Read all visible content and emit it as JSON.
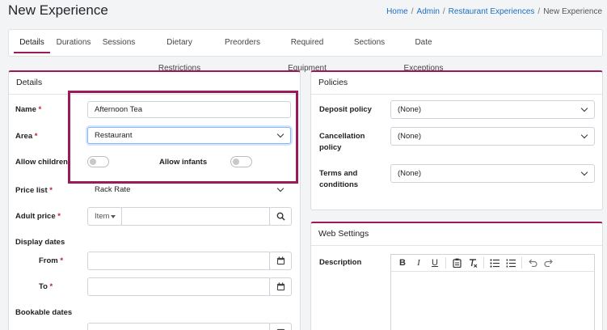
{
  "page": {
    "title": "New Experience"
  },
  "breadcrumb": {
    "items": [
      "Home",
      "Admin",
      "Restaurant Experiences"
    ],
    "current": "New Experience",
    "separator": "/"
  },
  "tabs": [
    "Details",
    "Durations",
    "Sessions",
    "Dietary Restrictions",
    "Preorders",
    "Required Equipment",
    "Sections",
    "Date Exceptions"
  ],
  "details": {
    "heading": "Details",
    "name_label": "Name",
    "name_value": "Afternoon Tea",
    "area_label": "Area",
    "area_value": "Restaurant",
    "allow_children_label": "Allow children",
    "allow_infants_label": "Allow infants",
    "price_list_label": "Price list",
    "price_list_value": "Rack Rate",
    "adult_price_label": "Adult price",
    "adult_price_type": "Item",
    "display_dates_label": "Display dates",
    "from_label": "From",
    "to_label": "To",
    "bookable_dates_label": "Bookable dates",
    "required_mark": "*"
  },
  "policies": {
    "heading": "Policies",
    "deposit_label": "Deposit policy",
    "deposit_value": "(None)",
    "cancellation_label_1": "Cancellation",
    "cancellation_label_2": "policy",
    "cancellation_value": "(None)",
    "terms_label_1": "Terms and",
    "terms_label_2": "conditions",
    "terms_value": "(None)"
  },
  "web_settings": {
    "heading": "Web Settings",
    "description_label": "Description",
    "toolbar": {
      "bold": "B",
      "italic": "I",
      "underline": "U"
    }
  },
  "colors": {
    "accent": "#9b1b5a",
    "link": "#1a6fc4",
    "required": "#c0202f"
  }
}
